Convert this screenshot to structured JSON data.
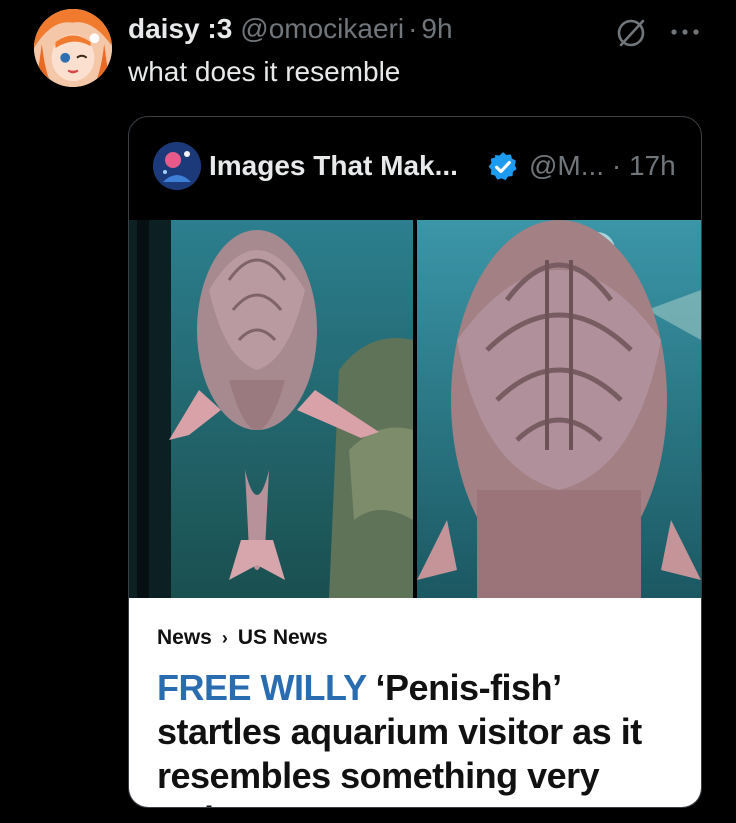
{
  "tweet": {
    "display_name": "daisy :3",
    "handle": "@omocikaeri",
    "separator": "·",
    "time": "9h",
    "text": "what does it resemble",
    "avatar_icon": "anime-girl-avatar",
    "grok_icon": "grok-slash-circle-icon",
    "more_icon": "more-horizontal-icon"
  },
  "quote": {
    "display_name": "Images That Mak...",
    "handle": "@M...",
    "separator": "·",
    "time": "17h",
    "verified_color": "#1d9bf0",
    "article": {
      "breadcrumb": [
        "News",
        "US News"
      ],
      "kicker": "FREE WILLY",
      "headline": " ‘Penis-fish’ startles aquarium visitor as it resembles something very rude",
      "kicker_color": "#2a6cb0"
    }
  }
}
